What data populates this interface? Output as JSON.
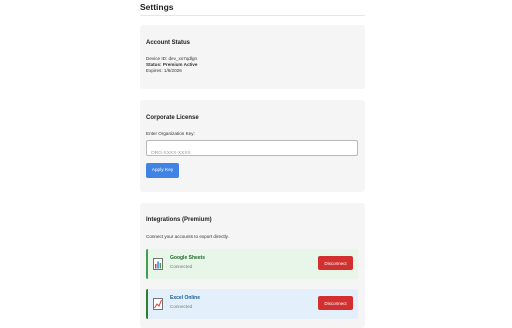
{
  "page": {
    "title": "Settings"
  },
  "account_status": {
    "title": "Account Status",
    "device_id_label": "Device ID:",
    "device_id": "dev_xo7qdlgn",
    "status_label": "Status:",
    "status_value": "Premium Active",
    "expires_label": "Expires:",
    "expires_value": "1/6/2026"
  },
  "corporate_license": {
    "title": "Corporate License",
    "field_label": "Enter Organization Key:",
    "input_placeholder": "ORG-XXXX-XXXX",
    "input_value": "",
    "apply_label": "Apply Key",
    "apply_color": "#3f84e5"
  },
  "integrations": {
    "title": "Integrations (Premium)",
    "description": "Connect your accounts to export directly.",
    "items": [
      {
        "name": "Google Sheets",
        "status": "Connected",
        "icon": "bar-chart-icon",
        "button": "Disconnect"
      },
      {
        "name": "Excel Online",
        "status": "Connected",
        "icon": "line-chart-icon",
        "button": "Disconnect"
      }
    ],
    "disconnect_color": "#d32f2f"
  }
}
